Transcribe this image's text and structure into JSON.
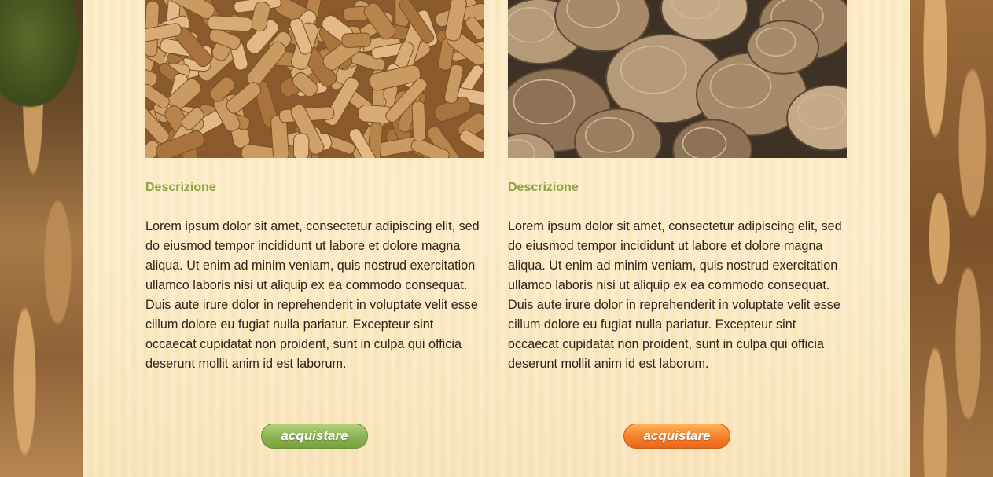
{
  "products": [
    {
      "image_name": "wood-pellets-image",
      "section_title": "Descrizione",
      "description": "Lorem ipsum dolor sit amet, consectetur adipiscing elit, sed do eiusmod tempor incididunt ut labore et dolore magna aliqua. Ut enim ad minim veniam, quis nostrud exercitation ullamco laboris nisi ut aliquip ex ea commodo consequat. Duis aute irure dolor in reprehenderit in voluptate velit esse cillum dolore eu fugiat nulla pariatur. Excepteur sint occaecat cupidatat non proident, sunt in culpa qui officia deserunt mollit anim id est laborum.",
      "button_label": "acquistare",
      "button_color": "#8db454"
    },
    {
      "image_name": "wood-briquettes-image",
      "section_title": "Descrizione",
      "description": "Lorem ipsum dolor sit amet, consectetur adipiscing elit, sed do eiusmod tempor incididunt ut labore et dolore magna aliqua. Ut enim ad minim veniam, quis nostrud exercitation ullamco laboris nisi ut aliquip ex ea commodo consequat. Duis aute irure dolor in reprehenderit in voluptate velit esse cillum dolore eu fugiat nulla pariatur. Excepteur sint occaecat cupidatat non proident, sunt in culpa qui officia deserunt mollit anim id est laborum.",
      "button_label": "acquistare",
      "button_color": "#f5822a"
    }
  ],
  "colors": {
    "title_green": "#8aa445",
    "panel_background": "#fcecc8",
    "text_dark": "#2e2418"
  }
}
